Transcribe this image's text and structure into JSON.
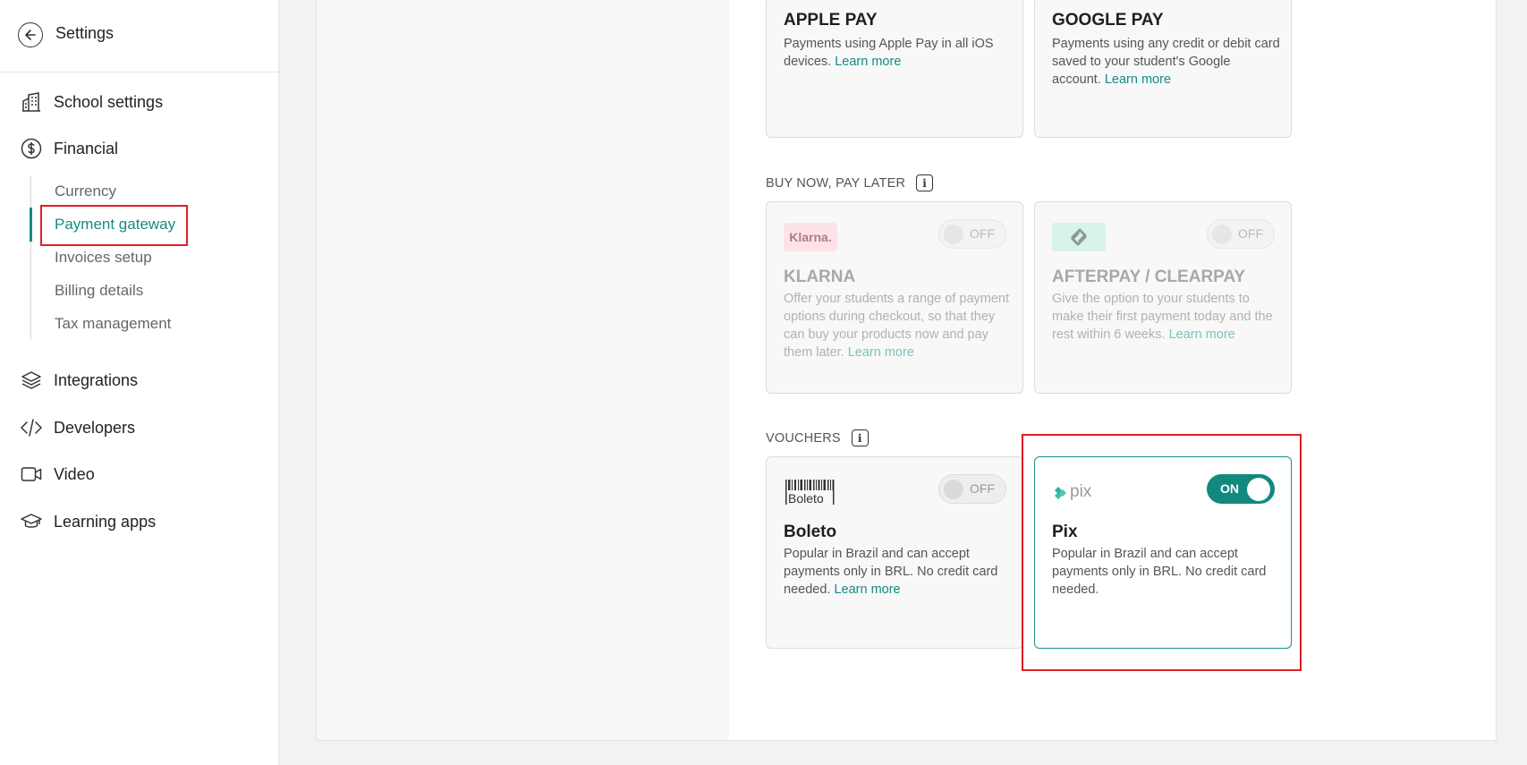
{
  "sidebar": {
    "header": {
      "title": "Settings",
      "back_icon": "back-arrow-icon"
    },
    "items": [
      {
        "label": "School settings",
        "icon": "building-icon"
      },
      {
        "label": "Financial",
        "icon": "dollar-icon"
      },
      {
        "label": "Integrations",
        "icon": "layers-icon"
      },
      {
        "label": "Developers",
        "icon": "code-icon"
      },
      {
        "label": "Video",
        "icon": "video-icon"
      },
      {
        "label": "Learning apps",
        "icon": "graduation-cap-icon"
      }
    ],
    "financial_sub": [
      {
        "label": "Currency"
      },
      {
        "label": "Payment gateway",
        "active": true
      },
      {
        "label": "Invoices setup"
      },
      {
        "label": "Billing details"
      },
      {
        "label": "Tax management"
      }
    ]
  },
  "wallets": {
    "apple_pay": {
      "name": "APPLE PAY",
      "desc": "Payments using Apple Pay in all iOS devices.",
      "link": "Learn more"
    },
    "google_pay": {
      "name": "GOOGLE PAY",
      "desc": "Payments using any credit or debit card saved to your student's Google account.",
      "link": "Learn more"
    }
  },
  "bnpl": {
    "title": "BUY NOW, PAY LATER",
    "klarna": {
      "logo": "Klarna.",
      "name": "KLARNA",
      "desc": "Offer your students a range of payment options during checkout, so that they can buy your products now and pay them later.",
      "link": "Learn more",
      "toggle": "OFF"
    },
    "afterpay": {
      "name": "AFTERPAY / CLEARPAY",
      "desc": "Give the option to your students to make their first payment today and the rest within 6 weeks.",
      "link": "Learn more",
      "toggle": "OFF"
    }
  },
  "vouchers": {
    "title": "VOUCHERS",
    "boleto": {
      "logo": "Boleto",
      "name": "Boleto",
      "desc": "Popular in Brazil and can accept payments only in BRL. No credit card needed.",
      "link": "Learn more",
      "toggle": "OFF"
    },
    "pix": {
      "logo": "pix",
      "name": "Pix",
      "desc": "Popular in Brazil and can accept payments only in BRL. No credit card needed.",
      "toggle": "ON"
    }
  },
  "colors": {
    "accent": "#138b85",
    "highlight": "#e01e26"
  }
}
